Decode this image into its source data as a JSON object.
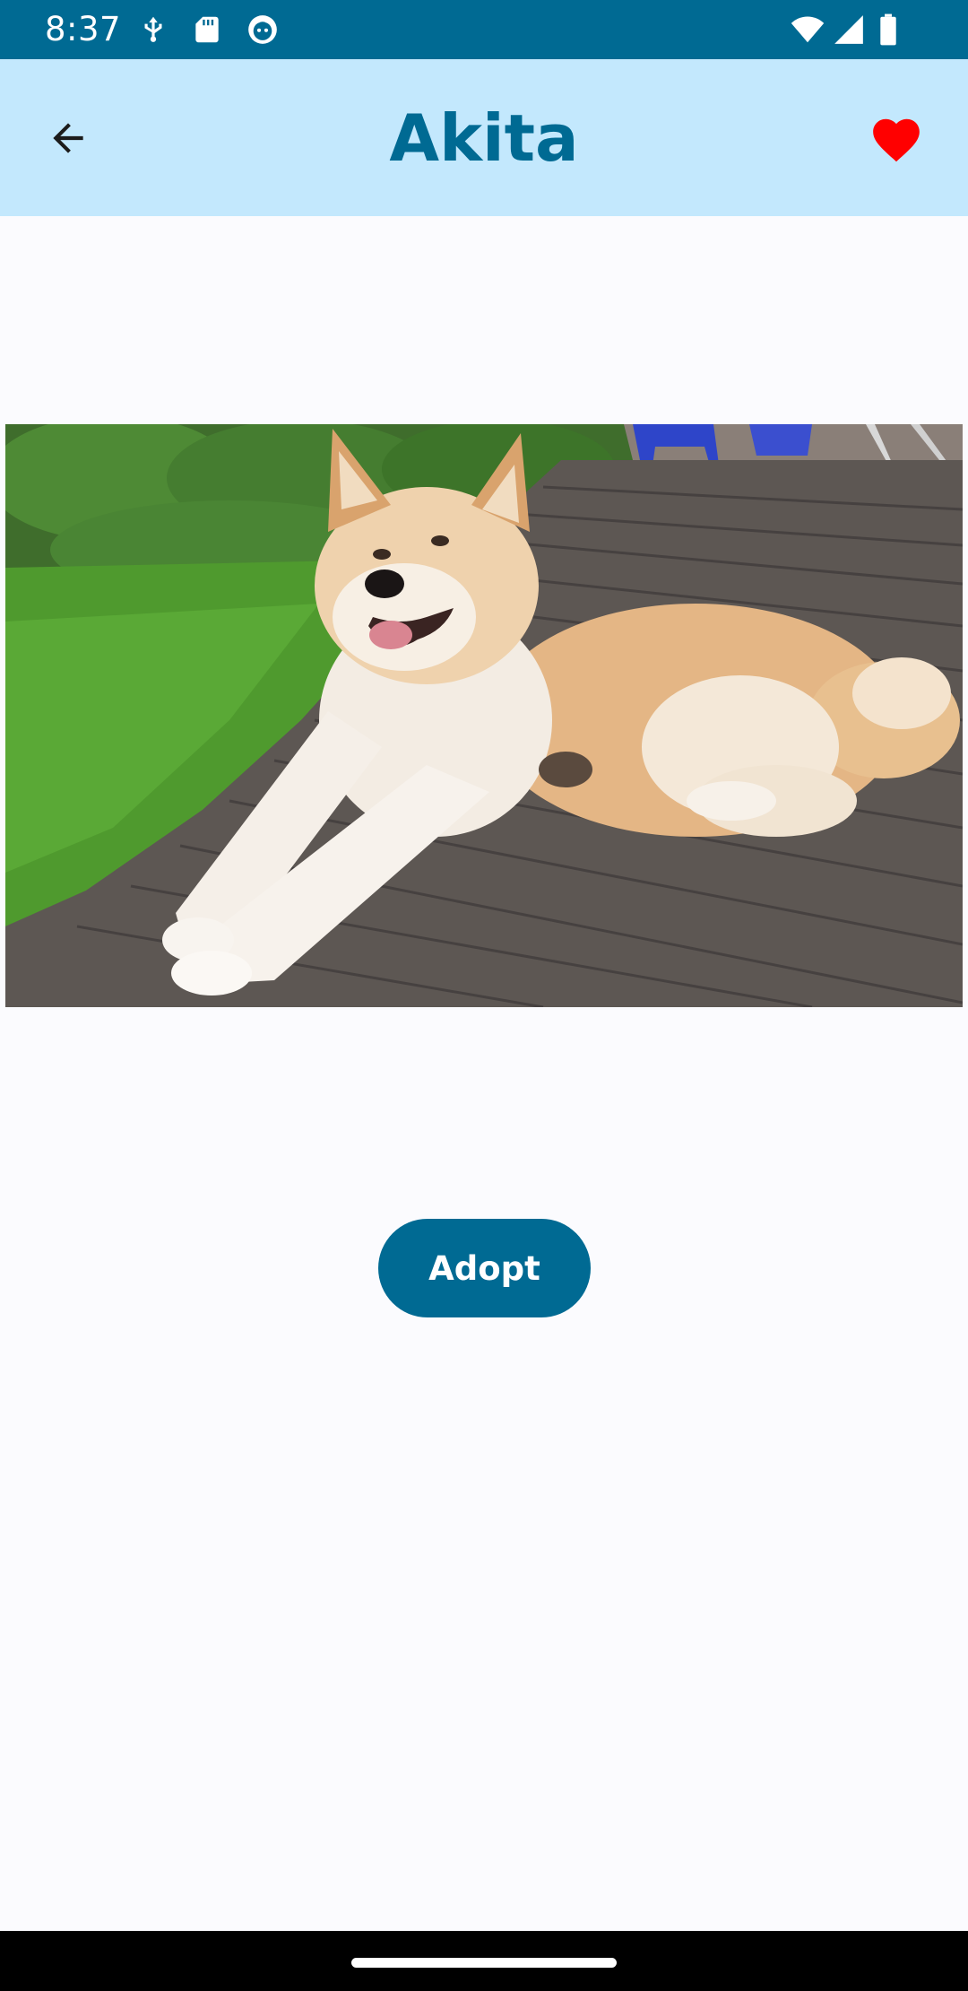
{
  "status_bar": {
    "time": "8:37",
    "left_icons": [
      "usb-debug-icon",
      "sd-card-icon",
      "cat-face-icon"
    ],
    "right_icons": [
      "wifi-icon",
      "cell-signal-icon",
      "battery-icon"
    ],
    "background_color": "#006a93"
  },
  "app_bar": {
    "title": "Akita",
    "back_icon": "arrow-back-icon",
    "favorite_icon": "heart-icon",
    "favorite_color": "#ff0000",
    "background_color": "#c3e8fd",
    "title_color": "#006a93"
  },
  "photo": {
    "subject": "dog-photo"
  },
  "actions": {
    "adopt_label": "Adopt",
    "button_color": "#006a93"
  }
}
